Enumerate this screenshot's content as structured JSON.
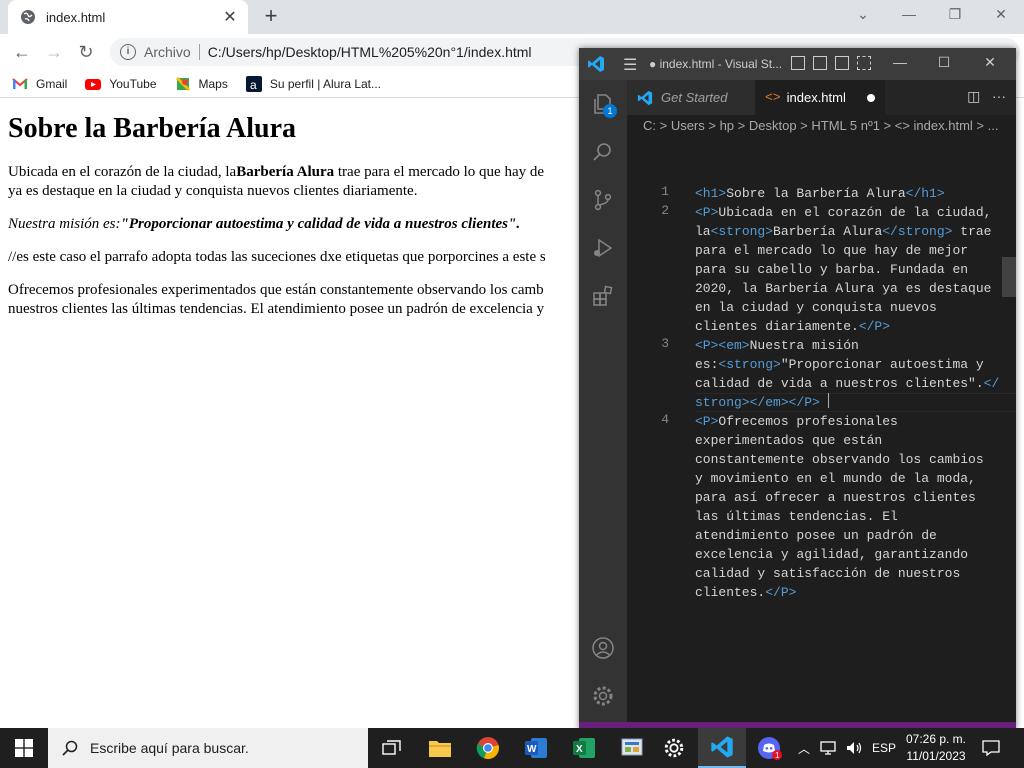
{
  "browser": {
    "tab_title": "index.html",
    "tab_close": "✕",
    "new_tab": "+",
    "window_controls": [
      "⌄",
      "—",
      "❐",
      "✕"
    ],
    "address_scheme": "Archivo",
    "address_url": "C:/Users/hp/Desktop/HTML%205%20n°1/index.html",
    "bookmarks": [
      {
        "label": "Gmail",
        "icon": "gmail-icon"
      },
      {
        "label": "YouTube",
        "icon": "youtube-icon"
      },
      {
        "label": "Maps",
        "icon": "maps-icon"
      },
      {
        "label": "Su perfil | Alura Lat...",
        "icon": "alura-icon"
      }
    ]
  },
  "page": {
    "heading": "Sobre la Barbería Alura",
    "p1_a": "Ubicada en el corazón de la ciudad, la",
    "p1_b": "Barbería Alura",
    "p1_c": " trae para el mercado lo que hay de",
    "p1_d": "ya es destaque en la ciudad y conquista nuevos clientes diariamente.",
    "p2_em": "Nuestra misión es:",
    "p2_strong": "\"Proporcionar autoestima y calidad de vida a nuestros clientes\".",
    "p3": "//es este caso el parrafo adopta todas las suceciones dxe etiquetas que porporcines a este s",
    "p4_a": "Ofrecemos profesionales experimentados que están constantemente observando los camb",
    "p4_b": "nuestros clientes las últimas tendencias. El atendimiento posee un padrón de excelencia y"
  },
  "vscode": {
    "title": "● index.html - Visual St...",
    "tabs": {
      "get_started": "Get Started",
      "active": "index.html"
    },
    "breadcrumb": "C: > Users > hp > Desktop > HTML 5 nº1 > <> index.html > ...",
    "source_control_badge": "1",
    "line_numbers": [
      "1",
      "2",
      "3",
      "4"
    ],
    "code": {
      "l1_tag_open": "<h1>",
      "l1_text": "Sobre la Barbería Alura",
      "l1_tag_close": "</h1>",
      "l2_r1_tag": "<P>",
      "l2_r1_text": "Ubicada en el corazón de la ciudad,",
      "l2_r2_a": "la",
      "l2_r2_tag1": "<strong>",
      "l2_r2_text": "Barbería Alura",
      "l2_r2_tag2": "</strong>",
      "l2_r2_b": " trae",
      "l2_r3": "para el mercado lo que hay de mejor",
      "l2_r4": "para su cabello y barba. Fundada en",
      "l2_r5": "2020, la Barbería Alura ya es destaque",
      "l2_r6": "en la ciudad y conquista nuevos",
      "l2_r7_text": "clientes diariamente.",
      "l2_r7_tag": "</P>",
      "l3_r1_tag1": "<P>",
      "l3_r1_tag2": "<em>",
      "l3_r1_text": "Nuestra misión",
      "l3_r2_text": "es:",
      "l3_r2_tag": "<strong>",
      "l3_r2_text2": "\"Proporcionar autoestima y",
      "l3_r3_text": "calidad de vida a nuestros clientes\".",
      "l3_r3_tag": "</",
      "l3_r4_tag": "strong></em></P>",
      "l4_r1_tag": "<P>",
      "l4_r1_text": "Ofrecemos profesionales",
      "l4_r2": "experimentados que están",
      "l4_r3": "constantemente observando los cambios",
      "l4_r4": "y movimiento en el mundo de la moda,",
      "l4_r5": "para así ofrecer a nuestros clientes",
      "l4_r6": "las últimas tendencias. El",
      "l4_r7": "atendimiento posee un padrón de",
      "l4_r8": "excelencia y agilidad, garantizando",
      "l4_r9": "calidad y satisfacción de nuestros",
      "l4_r10_text": "clientes.",
      "l4_r10_tag": "</P>"
    }
  },
  "taskbar": {
    "search_placeholder": "Escribe aquí para buscar.",
    "language": "ESP",
    "time": "07:26 p. m.",
    "date": "11/01/2023",
    "discord_badge": "1"
  },
  "colors": {
    "vscode_accent": "#0078d4",
    "statusbar": "#68217a",
    "tag": "#569cd6"
  }
}
